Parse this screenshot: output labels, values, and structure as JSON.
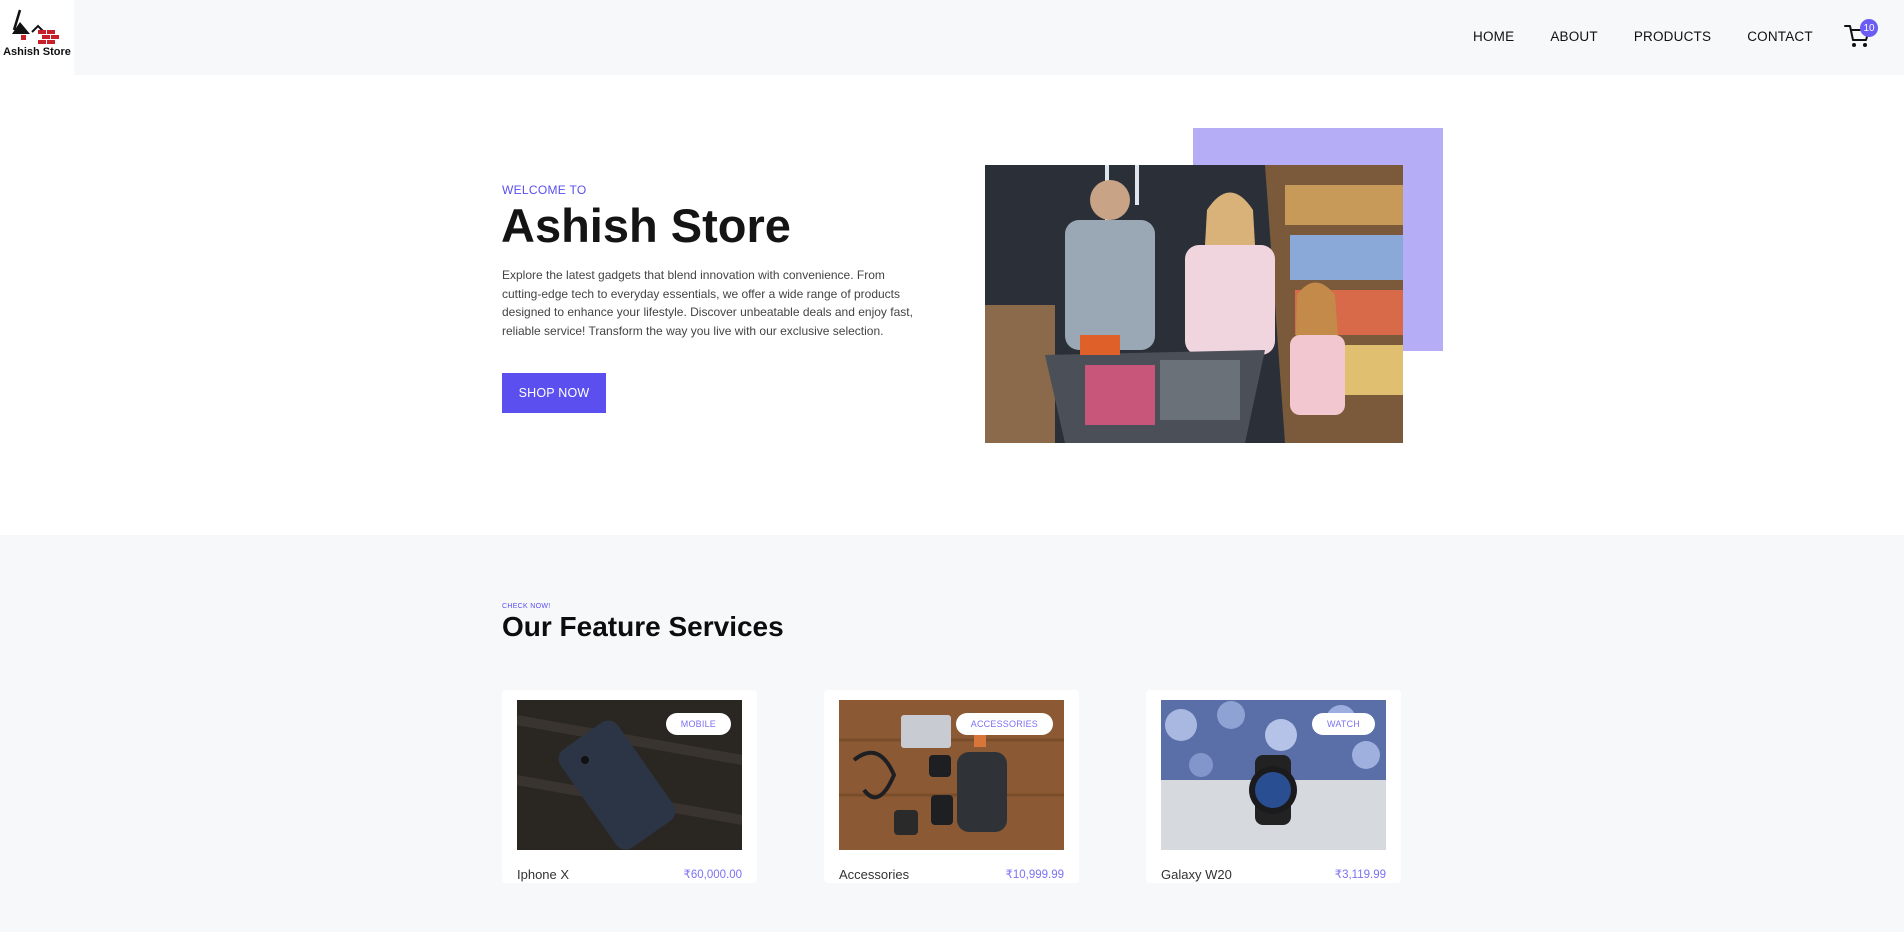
{
  "header": {
    "logo_text": "Ashish Store",
    "nav": [
      "HOME",
      "ABOUT",
      "PRODUCTS",
      "CONTACT"
    ],
    "cart_count": "10",
    "cart_icon": "cart-icon"
  },
  "hero": {
    "eyebrow": "WELCOME TO",
    "title": "Ashish Store",
    "description": "Explore the latest gadgets that blend innovation with convenience. From cutting-edge tech to everyday essentials, we offer a wide range of products designed to enhance your lifestyle. Discover unbeatable deals and enjoy fast, reliable service! Transform the way you live with our exclusive selection.",
    "button": "SHOP NOW",
    "accent_color": "#b5adf6",
    "brand_color": "#5b4ff0"
  },
  "services": {
    "eyebrow": "CHECK NOW!",
    "title": "Our Feature Services",
    "cards": [
      {
        "tag": "MOBILE",
        "name": "Iphone X",
        "price": "₹60,000.00"
      },
      {
        "tag": "ACCESSORIES",
        "name": "Accessories",
        "price": "₹10,999.99"
      },
      {
        "tag": "WATCH",
        "name": "Galaxy W20",
        "price": "₹3,119.99"
      }
    ]
  }
}
